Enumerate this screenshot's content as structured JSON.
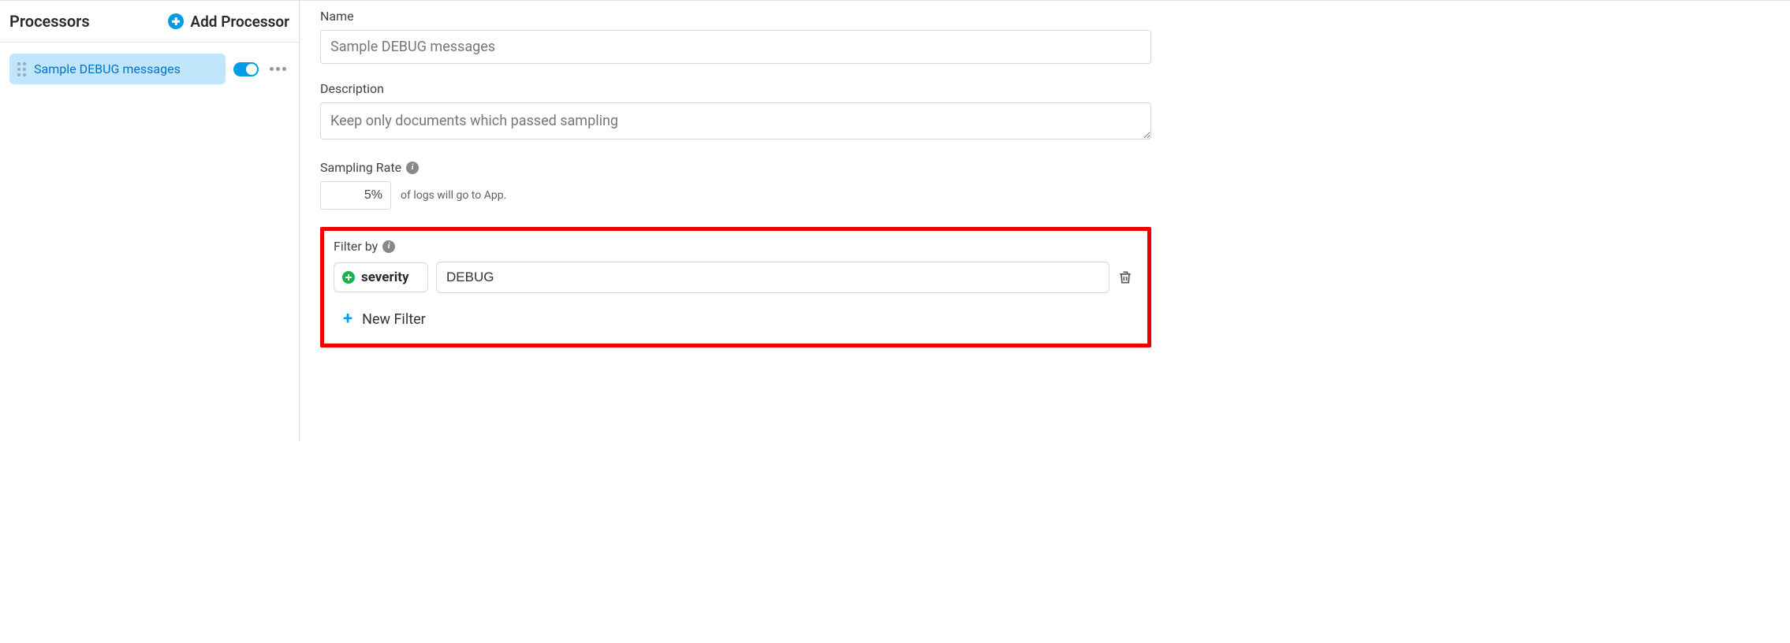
{
  "sidebar": {
    "title": "Processors",
    "add_label": "Add Processor",
    "items": [
      {
        "name": "Sample DEBUG messages",
        "enabled": true
      }
    ]
  },
  "form": {
    "name_label": "Name",
    "name_value": "Sample DEBUG messages",
    "description_label": "Description",
    "description_value": "Keep only documents which passed sampling",
    "sampling_rate_label": "Sampling Rate",
    "sampling_rate_value": "5%",
    "sampling_rate_suffix": "of logs will go to App.",
    "filter_label": "Filter by",
    "filters": [
      {
        "key": "severity",
        "value": "DEBUG"
      }
    ],
    "new_filter_label": "New Filter"
  }
}
